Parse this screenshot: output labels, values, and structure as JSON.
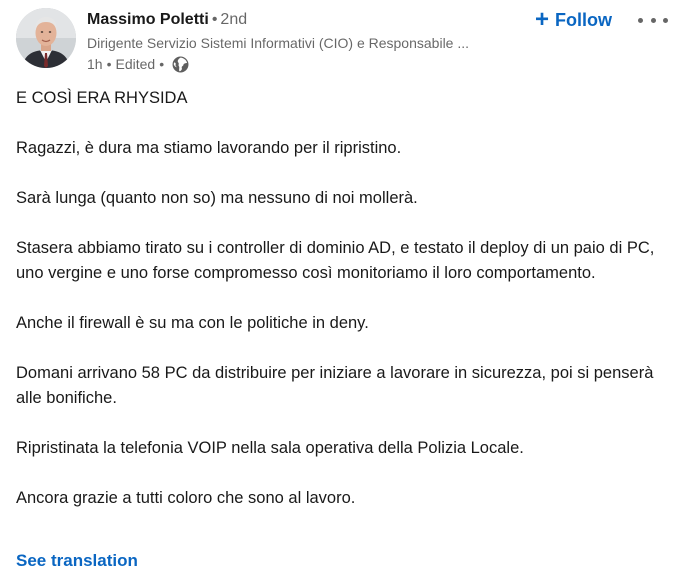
{
  "author": {
    "name": "Massimo Poletti",
    "degree": "2nd",
    "headline": "Dirigente Servizio Sistemi Informativi (CIO) e Responsabile ...",
    "time": "1h",
    "edited": "Edited",
    "visibility_icon": "globe-icon"
  },
  "actions": {
    "follow_label": "Follow",
    "follow_icon": "plus-icon",
    "more_icon": "more-options-icon"
  },
  "post": {
    "paragraphs": [
      "E COSÌ ERA RHYSIDA",
      "Ragazzi, è dura ma stiamo lavorando per il ripristino.",
      "Sarà lunga (quanto non so) ma nessuno di noi mollerà.",
      "Stasera abbiamo tirato su i controller di dominio AD, e testato il deploy di un paio di PC, uno vergine e uno forse compromesso così monitoriamo il loro comportamento.",
      "Anche il firewall è su ma con le politiche in deny.",
      "Domani arrivano 58 PC da distribuire per iniziare a lavorare in sicurezza, poi si penserà alle bonifiche.",
      "Ripristinata la telefonia VOIP nella sala operativa della Polizia Locale.",
      "Ancora grazie a tutti coloro che sono al lavoro."
    ],
    "see_translation": "See translation"
  },
  "colors": {
    "accent": "#0a66c2",
    "text_primary": "#1f1f1f",
    "text_secondary": "#666666"
  }
}
